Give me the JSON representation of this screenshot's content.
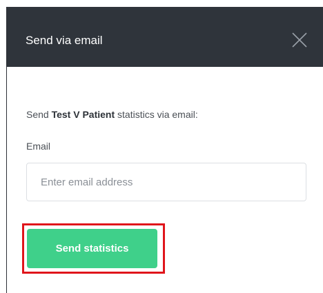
{
  "modal": {
    "title": "Send via email",
    "close_icon": "close-x-icon"
  },
  "body": {
    "intro_prefix": "Send ",
    "patient_name": "Test V Patient",
    "intro_suffix": " statistics via email:",
    "email_label": "Email",
    "email_placeholder": "Enter email address",
    "email_value": "",
    "send_button_label": "Send statistics"
  },
  "colors": {
    "header_bg": "#2f343b",
    "button_bg": "#3fd08a",
    "highlight_border": "#e0151b"
  }
}
